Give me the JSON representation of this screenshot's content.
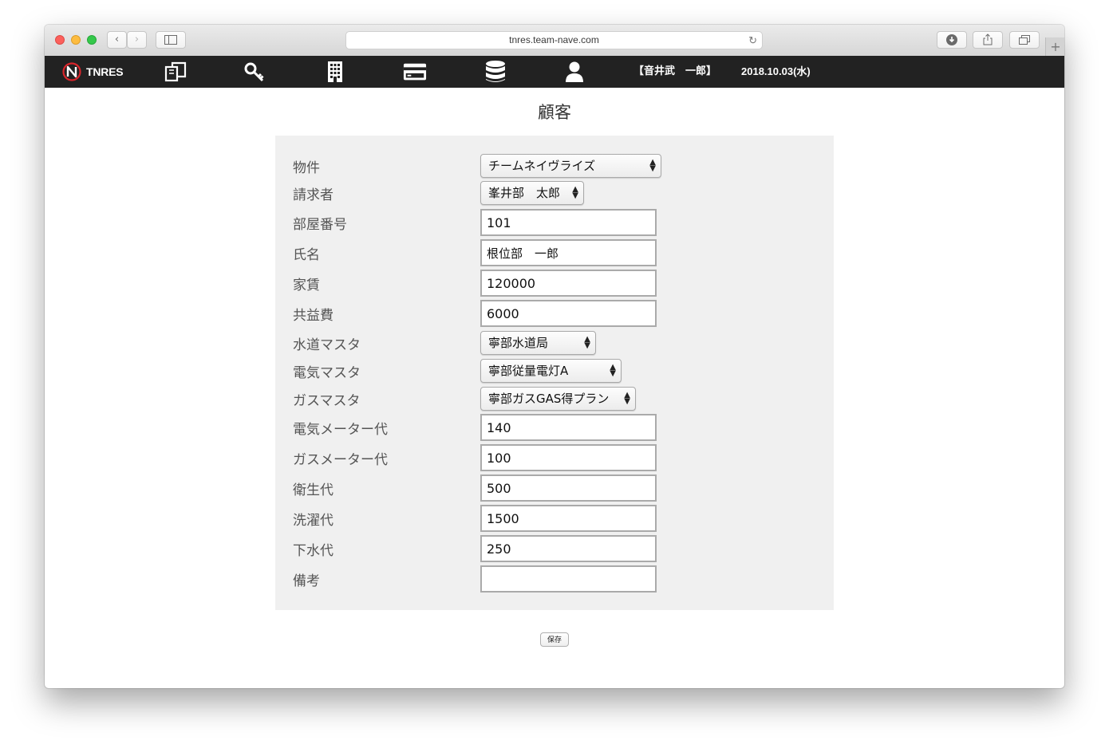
{
  "browser": {
    "url": "tnres.team-nave.com"
  },
  "navbar": {
    "brand": "TNRES",
    "user": "【音井武　一郎】",
    "date": "2018.10.03(水)",
    "icons": [
      "documents-icon",
      "key-icon",
      "building-icon",
      "credit-card-icon",
      "database-icon",
      "user-icon"
    ]
  },
  "page": {
    "title": "顧客"
  },
  "form": {
    "property": {
      "label": "物件",
      "value": "チームネイヴライズ"
    },
    "billing": {
      "label": "請求者",
      "value": "峯井部　太郎"
    },
    "room_number": {
      "label": "部屋番号",
      "value": "101"
    },
    "name": {
      "label": "氏名",
      "value": "根位部　一郎"
    },
    "rent": {
      "label": "家賃",
      "value": "120000"
    },
    "common_fee": {
      "label": "共益費",
      "value": "6000"
    },
    "water_master": {
      "label": "水道マスタ",
      "value": "寧部水道局"
    },
    "electric_master": {
      "label": "電気マスタ",
      "value": "寧部従量電灯A"
    },
    "gas_master": {
      "label": "ガスマスタ",
      "value": "寧部ガスGAS得プラン"
    },
    "electric_meter_fee": {
      "label": "電気メーター代",
      "value": "140"
    },
    "gas_meter_fee": {
      "label": "ガスメーター代",
      "value": "100"
    },
    "sanitation_fee": {
      "label": "衛生代",
      "value": "500"
    },
    "laundry_fee": {
      "label": "洗濯代",
      "value": "1500"
    },
    "sewage_fee": {
      "label": "下水代",
      "value": "250"
    },
    "notes": {
      "label": "備考",
      "value": ""
    },
    "save_label": "保存"
  },
  "colors": {
    "navbar": "#222222",
    "panel": "#f0f0f0",
    "brand_accent": "#d9252b"
  }
}
